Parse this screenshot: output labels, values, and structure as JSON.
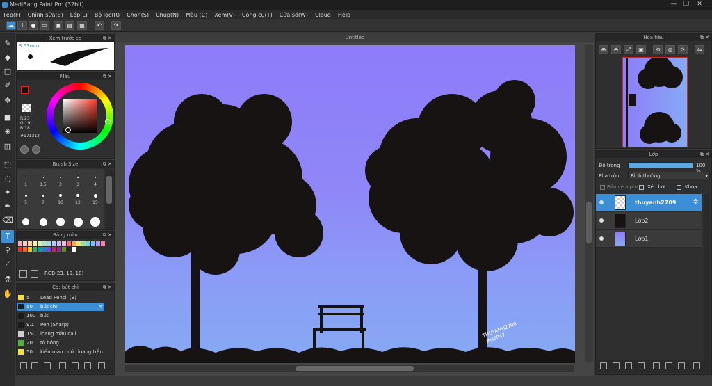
{
  "window": {
    "title": "MediBang Paint Pro (32bit)",
    "min": "—",
    "max": "❐",
    "close": "✕"
  },
  "menu": [
    "Tệp(F)",
    "Chỉnh sửa(E)",
    "Lớp(L)",
    "Bộ lọc(R)",
    "Chọn(S)",
    "Chụp(N)",
    "Màu (C)",
    "Xem(V)",
    "Công cụ(T)",
    "Cửa sổ(W)",
    "Cloud",
    "Help"
  ],
  "brush_preview": {
    "title": "Xem trước cọ",
    "size": "3.63mm"
  },
  "color": {
    "title": "Màu",
    "r": "R:23",
    "g": "G:19",
    "b": "B:18",
    "hex": "#171312",
    "primary": "#171312",
    "secondary": "#ffffff"
  },
  "brush_size": {
    "title": "Brush Size",
    "sizes": [
      "1",
      "1.5",
      "2",
      "3",
      "4",
      "5",
      "7",
      "10",
      "12",
      "15"
    ]
  },
  "palette": {
    "title": "Bảng màu",
    "rgb": "RGB(23, 19, 18)"
  },
  "brushes": {
    "title": "Cọ: bút chì",
    "items": [
      {
        "size": "5",
        "name": "Lead Pencil (B)",
        "color": "#f4e04d"
      },
      {
        "size": "50",
        "name": "bút chì",
        "color": "#1a1a1a"
      },
      {
        "size": "100",
        "name": "bút",
        "color": "#1a1a1a"
      },
      {
        "size": "9.1",
        "name": "Pen (Sharp)",
        "color": "#1a1a1a"
      },
      {
        "size": "150",
        "name": "loang màu call",
        "color": "#cfcfcf"
      },
      {
        "size": "20",
        "name": "tô bóng",
        "color": "#4fb43e"
      },
      {
        "size": "50",
        "name": "kiểu màu nước loang trên",
        "color": "#f2e34a"
      }
    ]
  },
  "document": {
    "tab": "Untitled",
    "signature_line1": "THUYANH2709",
    "signature_line2": "#HSP47"
  },
  "navigator": {
    "title": "Hoa tiêu"
  },
  "layers": {
    "title": "Lớp",
    "opacity_label": "Độ trong",
    "opacity_value": "100 %",
    "blend_label": "Pha trộn",
    "blend_value": "Bình thường",
    "protect_alpha": "Bảo vệ alpha",
    "clipping": "Xén bớt",
    "lock": "Khóa",
    "items": [
      {
        "name": "thuyanh2709",
        "selected": true
      },
      {
        "name": "Lớp2",
        "selected": false
      },
      {
        "name": "Lớp1",
        "selected": false
      }
    ]
  }
}
